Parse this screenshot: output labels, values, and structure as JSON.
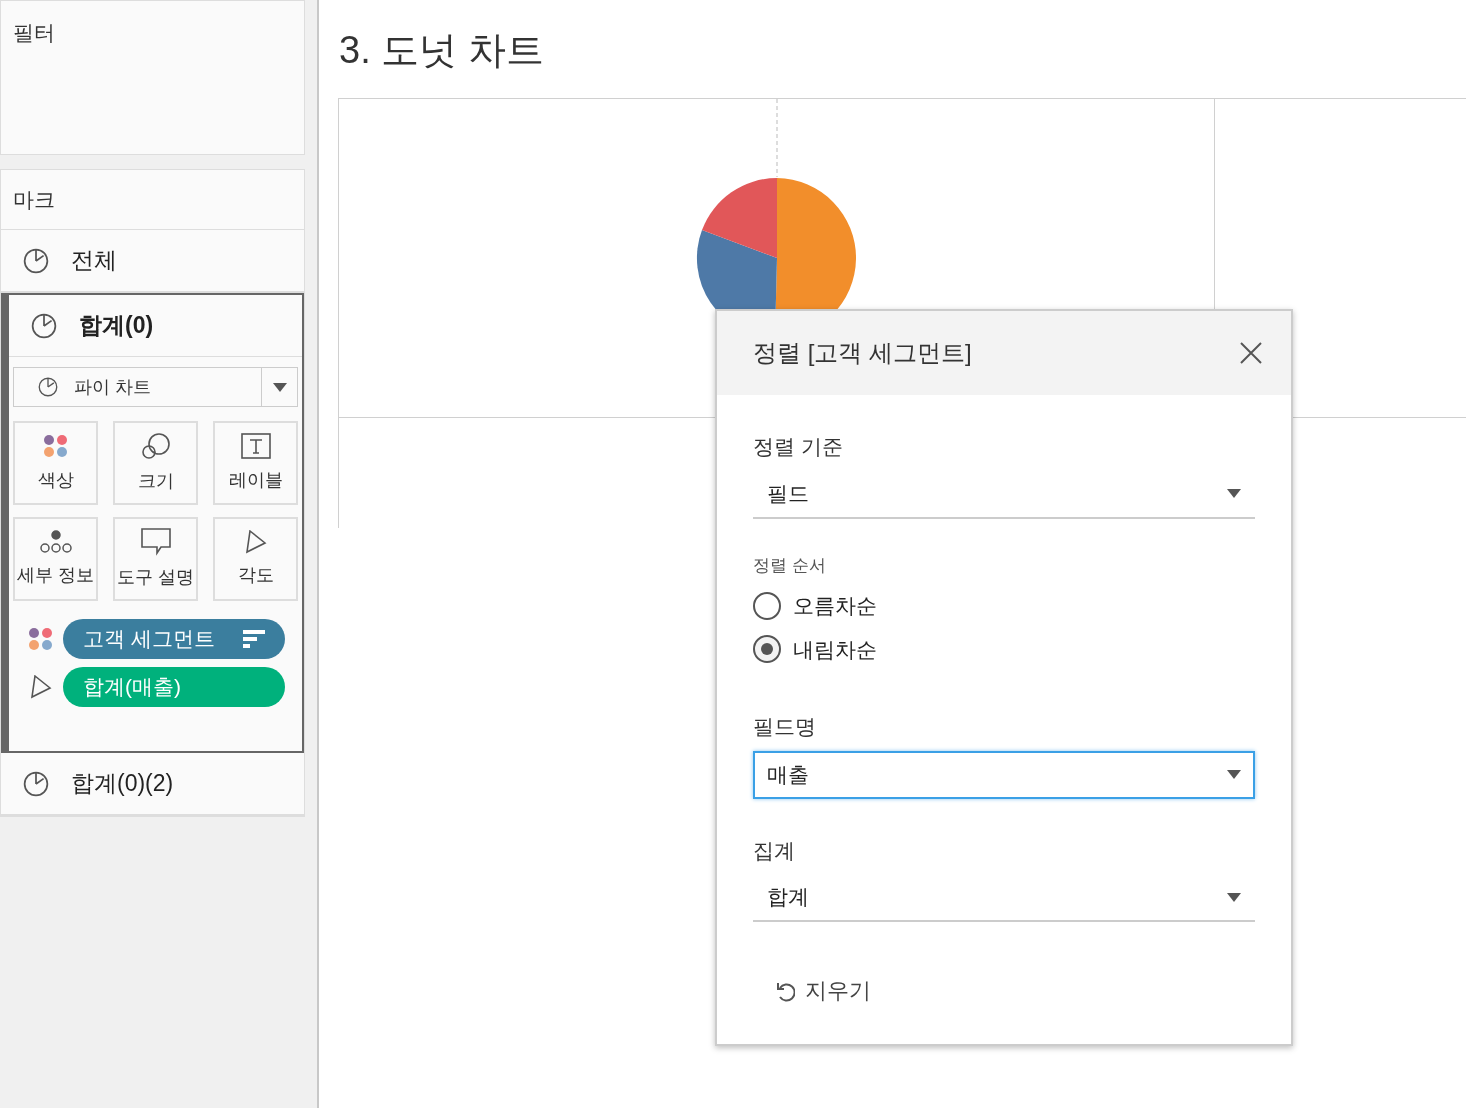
{
  "filters_panel": {
    "title": "필터"
  },
  "marks_panel": {
    "title": "마크",
    "mark_type": "파이 차트",
    "layers": [
      {
        "label": "전체",
        "selected": false
      },
      {
        "label": "합계(0)",
        "selected": true
      },
      {
        "label": "합계(0)(2)",
        "selected": false
      }
    ],
    "cards": [
      {
        "kind": "color",
        "label": "색상"
      },
      {
        "kind": "size",
        "label": "크기"
      },
      {
        "kind": "label",
        "label": "레이블"
      },
      {
        "kind": "detail",
        "label": "세부 정보"
      },
      {
        "kind": "tooltip",
        "label": "도구 설명"
      },
      {
        "kind": "angle",
        "label": "각도"
      }
    ],
    "pills": [
      {
        "kind": "color",
        "label": "고객 세그먼트",
        "color": "#3b7e9e",
        "sorted": true
      },
      {
        "kind": "angle",
        "label": "합계(매출)",
        "color": "#00b17c",
        "sorted": false
      }
    ]
  },
  "worksheet": {
    "title": "3. 도넛 차트"
  },
  "sort_dialog": {
    "title": "정렬 [고객 세그먼트]",
    "sort_by": {
      "label": "정렬 기준",
      "value": "필드"
    },
    "sort_order": {
      "label": "정렬 순서",
      "options": [
        {
          "label": "오름차순",
          "selected": false
        },
        {
          "label": "내림차순",
          "selected": true
        }
      ]
    },
    "field_name": {
      "label": "필드명",
      "value": "매출",
      "focused": true
    },
    "aggregation": {
      "label": "집계",
      "value": "합계"
    },
    "clear_button": "지우기"
  }
}
